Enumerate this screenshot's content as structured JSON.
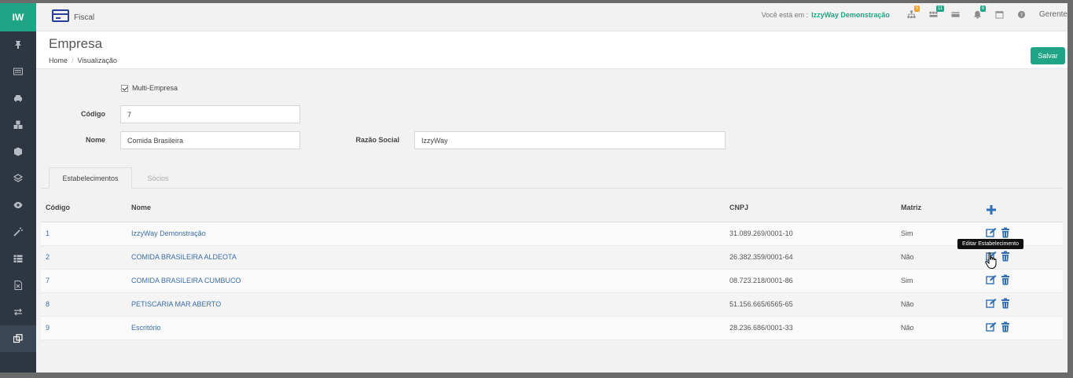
{
  "sidebar": {
    "logo": "IW",
    "items": [
      {
        "icon": "pin-icon"
      },
      {
        "icon": "list-card-icon"
      },
      {
        "icon": "car-icon"
      },
      {
        "icon": "cubes-icon"
      },
      {
        "icon": "cube-icon"
      },
      {
        "icon": "dropbox-icon"
      },
      {
        "icon": "eye-icon"
      },
      {
        "icon": "magic-wand-icon"
      },
      {
        "icon": "table-list-icon"
      },
      {
        "icon": "spreadsheet-icon"
      },
      {
        "icon": "exchange-icon"
      },
      {
        "icon": "copy-icon",
        "active": true
      }
    ]
  },
  "topbar": {
    "module": "Fiscal",
    "you_are_label": "Você está em :",
    "company": "IzzyWay Demonstração",
    "badges": {
      "orders": "5",
      "users": "11",
      "bell": "8"
    },
    "user": "Gerente"
  },
  "header": {
    "title": "Empresa",
    "breadcrumb_home": "Home",
    "breadcrumb_sep": "/",
    "breadcrumb_current": "Visualização",
    "save_label": "Salvar"
  },
  "form": {
    "multi_empresa_label": "Multi-Empresa",
    "codigo_label": "Código",
    "codigo_value": "7",
    "nome_label": "Nome",
    "nome_value": "Comida Brasileira",
    "razao_label": "Razão Social",
    "razao_value": "IzzyWay"
  },
  "tabs": {
    "estabelecimentos": "Estabelecimentos",
    "socios": "Sócios"
  },
  "table": {
    "headers": {
      "codigo": "Código",
      "nome": "Nome",
      "cnpj": "CNPJ",
      "matriz": "Matriz"
    },
    "rows": [
      {
        "codigo": "1",
        "nome": "IzzyWay Demonstração",
        "cnpj": "31.089.269/0001-10",
        "matriz": "Sim"
      },
      {
        "codigo": "2",
        "nome": "COMIDA BRASILEIRA ALDEOTA",
        "cnpj": "26.382.359/0001-64",
        "matriz": "Não"
      },
      {
        "codigo": "7",
        "nome": "COMIDA BRASILEIRA CUMBUCO",
        "cnpj": "08.723.218/0001-86",
        "matriz": "Sim"
      },
      {
        "codigo": "8",
        "nome": "PETISCARIA MAR ABERTO",
        "cnpj": "51.156.665/6565-65",
        "matriz": "Não"
      },
      {
        "codigo": "9",
        "nome": "Escritório",
        "cnpj": "28.236.686/0001-33",
        "matriz": "Não"
      }
    ]
  },
  "tooltip": "Editar Estabelecimento"
}
